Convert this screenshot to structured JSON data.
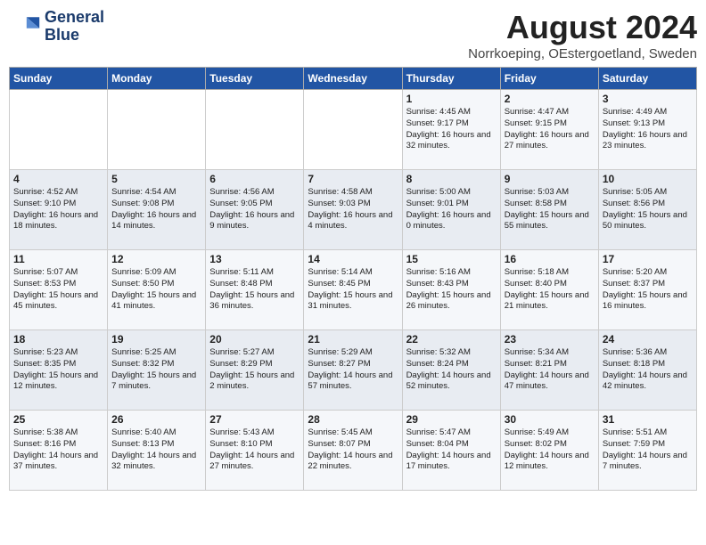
{
  "header": {
    "logo_line1": "General",
    "logo_line2": "Blue",
    "month_year": "August 2024",
    "location": "Norrkoeping, OEstergoetland, Sweden"
  },
  "weekdays": [
    "Sunday",
    "Monday",
    "Tuesday",
    "Wednesday",
    "Thursday",
    "Friday",
    "Saturday"
  ],
  "weeks": [
    [
      {
        "day": "",
        "info": ""
      },
      {
        "day": "",
        "info": ""
      },
      {
        "day": "",
        "info": ""
      },
      {
        "day": "",
        "info": ""
      },
      {
        "day": "1",
        "info": "Sunrise: 4:45 AM\nSunset: 9:17 PM\nDaylight: 16 hours\nand 32 minutes."
      },
      {
        "day": "2",
        "info": "Sunrise: 4:47 AM\nSunset: 9:15 PM\nDaylight: 16 hours\nand 27 minutes."
      },
      {
        "day": "3",
        "info": "Sunrise: 4:49 AM\nSunset: 9:13 PM\nDaylight: 16 hours\nand 23 minutes."
      }
    ],
    [
      {
        "day": "4",
        "info": "Sunrise: 4:52 AM\nSunset: 9:10 PM\nDaylight: 16 hours\nand 18 minutes."
      },
      {
        "day": "5",
        "info": "Sunrise: 4:54 AM\nSunset: 9:08 PM\nDaylight: 16 hours\nand 14 minutes."
      },
      {
        "day": "6",
        "info": "Sunrise: 4:56 AM\nSunset: 9:05 PM\nDaylight: 16 hours\nand 9 minutes."
      },
      {
        "day": "7",
        "info": "Sunrise: 4:58 AM\nSunset: 9:03 PM\nDaylight: 16 hours\nand 4 minutes."
      },
      {
        "day": "8",
        "info": "Sunrise: 5:00 AM\nSunset: 9:01 PM\nDaylight: 16 hours\nand 0 minutes."
      },
      {
        "day": "9",
        "info": "Sunrise: 5:03 AM\nSunset: 8:58 PM\nDaylight: 15 hours\nand 55 minutes."
      },
      {
        "day": "10",
        "info": "Sunrise: 5:05 AM\nSunset: 8:56 PM\nDaylight: 15 hours\nand 50 minutes."
      }
    ],
    [
      {
        "day": "11",
        "info": "Sunrise: 5:07 AM\nSunset: 8:53 PM\nDaylight: 15 hours\nand 45 minutes."
      },
      {
        "day": "12",
        "info": "Sunrise: 5:09 AM\nSunset: 8:50 PM\nDaylight: 15 hours\nand 41 minutes."
      },
      {
        "day": "13",
        "info": "Sunrise: 5:11 AM\nSunset: 8:48 PM\nDaylight: 15 hours\nand 36 minutes."
      },
      {
        "day": "14",
        "info": "Sunrise: 5:14 AM\nSunset: 8:45 PM\nDaylight: 15 hours\nand 31 minutes."
      },
      {
        "day": "15",
        "info": "Sunrise: 5:16 AM\nSunset: 8:43 PM\nDaylight: 15 hours\nand 26 minutes."
      },
      {
        "day": "16",
        "info": "Sunrise: 5:18 AM\nSunset: 8:40 PM\nDaylight: 15 hours\nand 21 minutes."
      },
      {
        "day": "17",
        "info": "Sunrise: 5:20 AM\nSunset: 8:37 PM\nDaylight: 15 hours\nand 16 minutes."
      }
    ],
    [
      {
        "day": "18",
        "info": "Sunrise: 5:23 AM\nSunset: 8:35 PM\nDaylight: 15 hours\nand 12 minutes."
      },
      {
        "day": "19",
        "info": "Sunrise: 5:25 AM\nSunset: 8:32 PM\nDaylight: 15 hours\nand 7 minutes."
      },
      {
        "day": "20",
        "info": "Sunrise: 5:27 AM\nSunset: 8:29 PM\nDaylight: 15 hours\nand 2 minutes."
      },
      {
        "day": "21",
        "info": "Sunrise: 5:29 AM\nSunset: 8:27 PM\nDaylight: 14 hours\nand 57 minutes."
      },
      {
        "day": "22",
        "info": "Sunrise: 5:32 AM\nSunset: 8:24 PM\nDaylight: 14 hours\nand 52 minutes."
      },
      {
        "day": "23",
        "info": "Sunrise: 5:34 AM\nSunset: 8:21 PM\nDaylight: 14 hours\nand 47 minutes."
      },
      {
        "day": "24",
        "info": "Sunrise: 5:36 AM\nSunset: 8:18 PM\nDaylight: 14 hours\nand 42 minutes."
      }
    ],
    [
      {
        "day": "25",
        "info": "Sunrise: 5:38 AM\nSunset: 8:16 PM\nDaylight: 14 hours\nand 37 minutes."
      },
      {
        "day": "26",
        "info": "Sunrise: 5:40 AM\nSunset: 8:13 PM\nDaylight: 14 hours\nand 32 minutes."
      },
      {
        "day": "27",
        "info": "Sunrise: 5:43 AM\nSunset: 8:10 PM\nDaylight: 14 hours\nand 27 minutes."
      },
      {
        "day": "28",
        "info": "Sunrise: 5:45 AM\nSunset: 8:07 PM\nDaylight: 14 hours\nand 22 minutes."
      },
      {
        "day": "29",
        "info": "Sunrise: 5:47 AM\nSunset: 8:04 PM\nDaylight: 14 hours\nand 17 minutes."
      },
      {
        "day": "30",
        "info": "Sunrise: 5:49 AM\nSunset: 8:02 PM\nDaylight: 14 hours\nand 12 minutes."
      },
      {
        "day": "31",
        "info": "Sunrise: 5:51 AM\nSunset: 7:59 PM\nDaylight: 14 hours\nand 7 minutes."
      }
    ]
  ]
}
